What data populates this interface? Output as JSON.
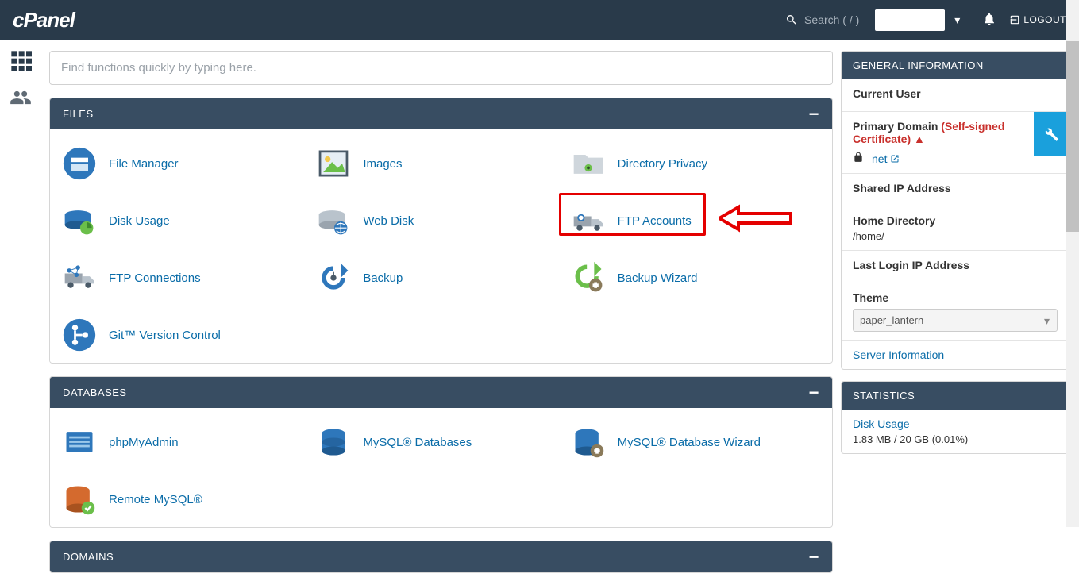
{
  "topbar": {
    "logo": "cPanel",
    "search_label": "Search ( / )",
    "logout": "LOGOUT"
  },
  "quicksearch": {
    "placeholder": "Find functions quickly by typing here."
  },
  "sections": {
    "files": {
      "title": "FILES",
      "items": {
        "file_manager": "File Manager",
        "images": "Images",
        "directory_privacy": "Directory Privacy",
        "disk_usage": "Disk Usage",
        "web_disk": "Web Disk",
        "ftp_accounts": "FTP Accounts",
        "ftp_connections": "FTP Connections",
        "backup": "Backup",
        "backup_wizard": "Backup Wizard",
        "git": "Git™ Version Control"
      }
    },
    "databases": {
      "title": "DATABASES",
      "items": {
        "phpmyadmin": "phpMyAdmin",
        "mysql_db": "MySQL® Databases",
        "mysql_wizard": "MySQL® Database Wizard",
        "remote_mysql": "Remote MySQL®"
      }
    },
    "domains": {
      "title": "DOMAINS"
    }
  },
  "general": {
    "title": "GENERAL INFORMATION",
    "current_user_label": "Current User",
    "primary_domain_label": "Primary Domain",
    "selfsigned": "(Self-signed Certificate)",
    "domain_suffix": "net",
    "shared_ip_label": "Shared IP Address",
    "home_dir_label": "Home Directory",
    "home_dir_value": "/home/",
    "last_login_label": "Last Login IP Address",
    "theme_label": "Theme",
    "theme_value": "paper_lantern",
    "server_info": "Server Information"
  },
  "stats": {
    "title": "STATISTICS",
    "disk_usage_label": "Disk Usage",
    "disk_usage_value": "1.83 MB / 20 GB   (0.01%)"
  }
}
